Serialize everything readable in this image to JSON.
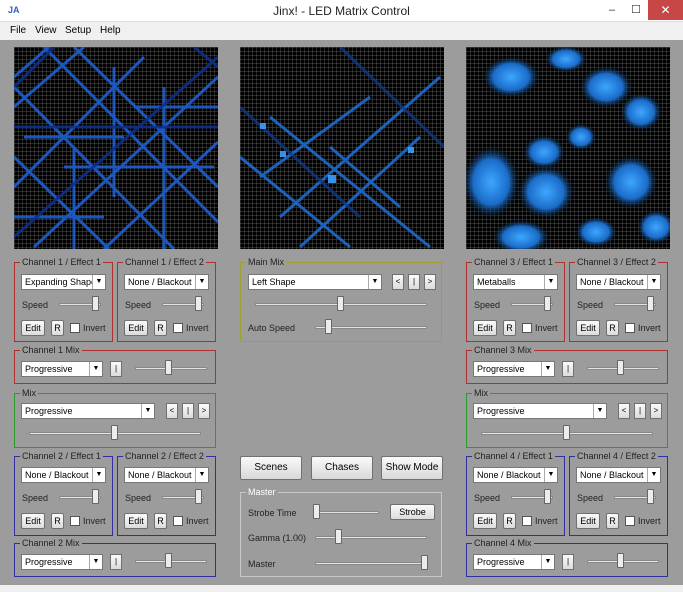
{
  "window": {
    "title": "Jinx! - LED Matrix Control",
    "icon": "JA",
    "minimize": "–",
    "maximize": "☐",
    "close": "✕"
  },
  "menu": [
    "File",
    "View",
    "Setup",
    "Help"
  ],
  "common": {
    "speed": "Speed",
    "edit": "Edit",
    "r": "R",
    "invert": "Invert",
    "bar": "|",
    "prev": "<",
    "next": ">"
  },
  "ch1": {
    "e1": {
      "label": "Channel 1 / Effect 1",
      "effect": "Expanding Shapes",
      "speed": 0.88
    },
    "e2": {
      "label": "Channel 1 / Effect 2",
      "effect": "None / Blackout",
      "speed": 0.88
    },
    "mix": {
      "label": "Channel 1 Mix",
      "mode": "Progressive",
      "value": 0.45
    }
  },
  "mix_left": {
    "label": "Mix",
    "mode": "Progressive",
    "value": 0.5
  },
  "ch2": {
    "e1": {
      "label": "Channel 2 / Effect 1",
      "effect": "None / Blackout",
      "speed": 0.88
    },
    "e2": {
      "label": "Channel 2 / Effect 2",
      "effect": "None / Blackout",
      "speed": 0.88
    },
    "mix": {
      "label": "Channel 2 Mix",
      "mode": "Progressive",
      "value": 0.45
    }
  },
  "main_mix": {
    "label": "Main Mix",
    "mode": "Left Shape",
    "value": 0.48,
    "auto_speed_label": "Auto Speed",
    "auto_speed": 0.1
  },
  "buttons": {
    "scenes": "Scenes",
    "chases": "Chases",
    "show_mode": "Show Mode"
  },
  "master": {
    "label": "Master",
    "strobe_time_label": "Strobe Time",
    "strobe_time": 0.0,
    "strobe_button": "Strobe",
    "gamma_label": "Gamma (1.00)",
    "gamma": 0.2,
    "master_label": "Master",
    "master": 0.98
  },
  "ch3": {
    "e1": {
      "label": "Channel 3 / Effect 1",
      "effect": "Metaballs",
      "speed": 0.88
    },
    "e2": {
      "label": "Channel 3 / Effect 2",
      "effect": "None / Blackout",
      "speed": 0.88
    },
    "mix": {
      "label": "Channel 3 Mix",
      "mode": "Progressive",
      "value": 0.45
    }
  },
  "mix_right": {
    "label": "Mix",
    "mode": "Progressive",
    "value": 0.5
  },
  "ch4": {
    "e1": {
      "label": "Channel 4 / Effect 1",
      "effect": "None / Blackout",
      "speed": 0.88
    },
    "e2": {
      "label": "Channel 4 / Effect 2",
      "effect": "None / Blackout",
      "speed": 0.88
    },
    "mix": {
      "label": "Channel 4 Mix",
      "mode": "Progressive",
      "value": 0.45
    }
  },
  "colors": {
    "led_blue": "#1e6fd9",
    "led_dark": "#0b1f5a",
    "metaball": "#2a8ee8"
  }
}
